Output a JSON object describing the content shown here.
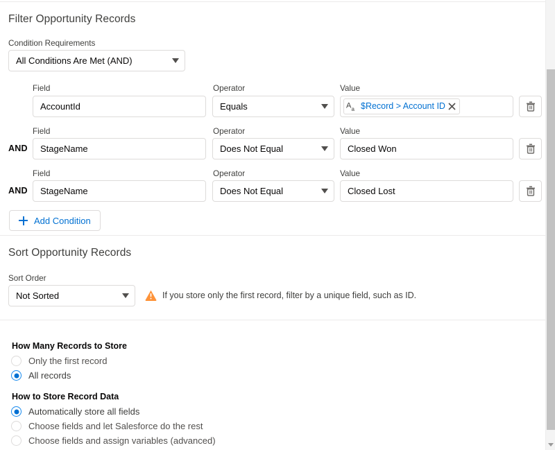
{
  "filter_section": {
    "title": "Filter Opportunity Records",
    "condition_requirements_label": "Condition Requirements",
    "condition_requirements_value": "All Conditions Are Met (AND)",
    "column_headers": {
      "field": "Field",
      "operator": "Operator",
      "value": "Value"
    },
    "logic_connector": "AND",
    "conditions": [
      {
        "connector": "",
        "field": "AccountId",
        "operator": "Equals",
        "value_type": "pill",
        "value_pill_icon": "text-data-type-icon",
        "value": "$Record > Account ID",
        "delete_icon": "trash-icon"
      },
      {
        "connector": "AND",
        "field": "StageName",
        "operator": "Does Not Equal",
        "value_type": "text",
        "value": "Closed Won",
        "delete_icon": "trash-icon"
      },
      {
        "connector": "AND",
        "field": "StageName",
        "operator": "Does Not Equal",
        "value_type": "text",
        "value": "Closed Lost",
        "delete_icon": "trash-icon"
      }
    ],
    "add_condition_label": "Add Condition",
    "add_condition_icon": "plus-icon"
  },
  "sort_section": {
    "title": "Sort Opportunity Records",
    "sort_order_label": "Sort Order",
    "sort_order_value": "Not Sorted",
    "warning_icon": "warning-triangle-icon",
    "warning_text": "If you store only the first record, filter by a unique field, such as ID."
  },
  "records_to_store": {
    "legend": "How Many Records to Store",
    "options": [
      {
        "label": "Only the first record",
        "selected": false
      },
      {
        "label": "All records",
        "selected": true
      }
    ]
  },
  "store_record_data": {
    "legend": "How to Store Record Data",
    "options": [
      {
        "label": "Automatically store all fields",
        "selected": true
      },
      {
        "label": "Choose fields and let Salesforce do the rest",
        "selected": false
      },
      {
        "label": "Choose fields and assign variables (advanced)",
        "selected": false
      }
    ]
  },
  "scrollbar": {
    "name": "vertical-scrollbar",
    "down_arrow_icon": "chevron-down-icon"
  },
  "colors": {
    "link_blue": "#0070d2",
    "selected_radio": "#0070d2",
    "warning_orange": "#fe9339",
    "border_gray": "#dddbda",
    "text_dark": "#080707",
    "text_muted": "#3e3e3c"
  }
}
